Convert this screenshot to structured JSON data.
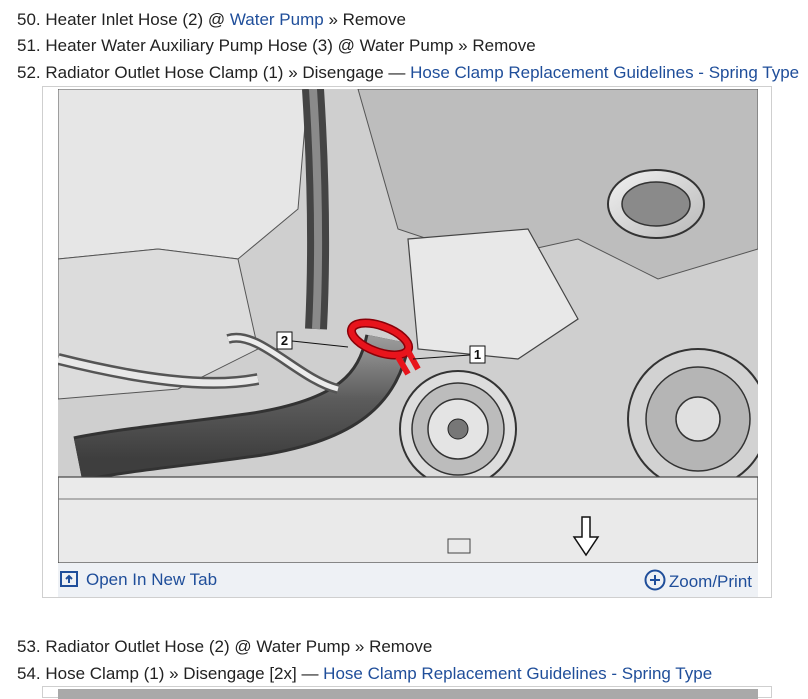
{
  "steps": [
    {
      "number": "50.",
      "text": "Heater Inlet Hose (2) @ ",
      "link": "Water Pump",
      "suffix": " » Remove"
    },
    {
      "number": "51.",
      "text": "Heater Water Auxiliary Pump Hose (3) @ Water Pump » Remove"
    },
    {
      "number": "52.",
      "text": "Radiator Outlet Hose Clamp (1) » Disengage — ",
      "link": "Hose Clamp Replacement Guidelines - Spring Type"
    },
    {
      "number": "53.",
      "text": "Radiator Outlet Hose (2) @ Water Pump » Remove"
    },
    {
      "number": "54.",
      "text": "Hose Clamp (1) » Disengage [2x] — ",
      "link": "Hose Clamp Replacement Guidelines - Spring Type"
    }
  ],
  "figure": {
    "callouts": [
      "1",
      "2"
    ],
    "open_tab_label": "Open In New Tab",
    "zoom_label": "Zoom/Print",
    "open_tab_icon": "open-new-tab-icon",
    "zoom_icon": "zoom-plus-icon",
    "accent_color": "#1f4e9a",
    "clamp_color": "#e8141c"
  }
}
